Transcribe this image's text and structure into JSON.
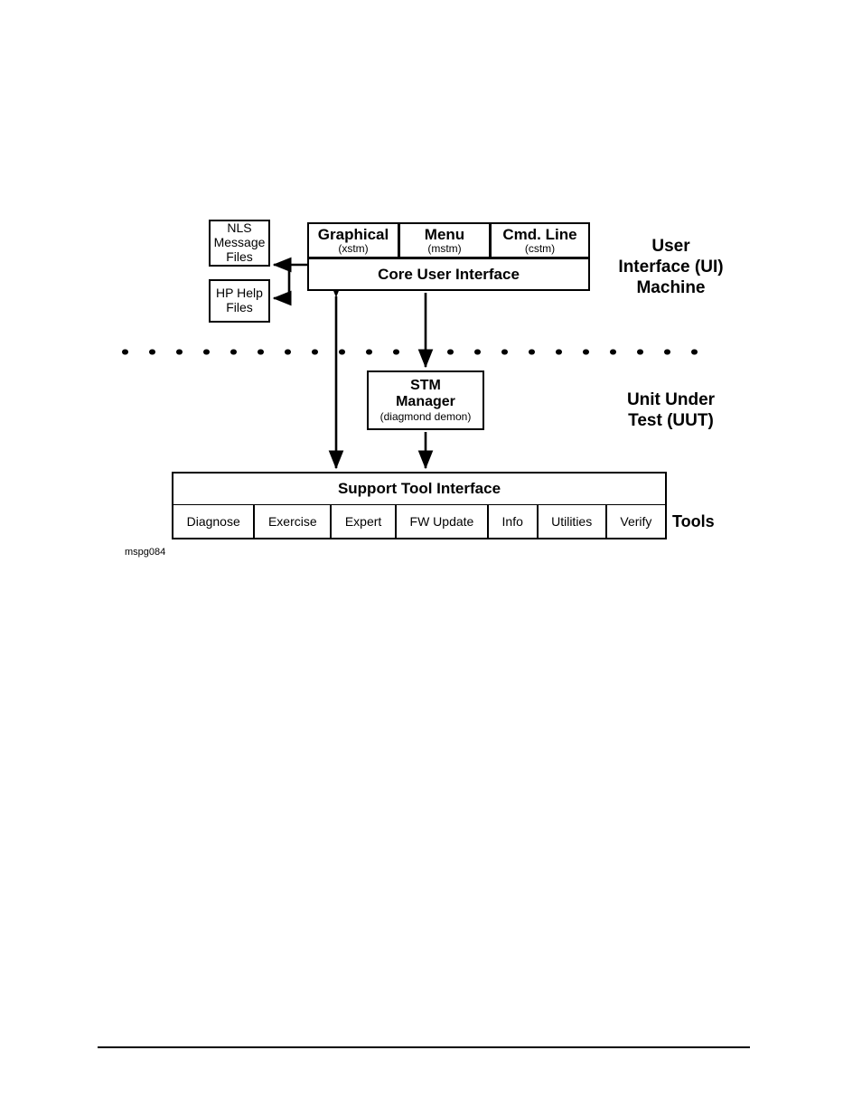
{
  "diagram": {
    "caption": "mspg084",
    "left_boxes": [
      {
        "name": "nls-message-files",
        "lines": [
          "NLS",
          "Message",
          "Files"
        ]
      },
      {
        "name": "hp-help-files",
        "lines": [
          "HP Help",
          "Files"
        ]
      }
    ],
    "interfaces": [
      {
        "title": "Graphical",
        "sub": "(xstm)"
      },
      {
        "title": "Menu",
        "sub": "(mstm)"
      },
      {
        "title": "Cmd. Line",
        "sub": "(cstm)"
      }
    ],
    "core_ui": "Core User Interface",
    "stm_manager": {
      "title_line1": "STM",
      "title_line2": "Manager",
      "sub": "(diagmond demon)"
    },
    "support_tool_interface": "Support Tool Interface",
    "tools": [
      "Diagnose",
      "Exercise",
      "Expert",
      "FW Update",
      "Info",
      "Utilities",
      "Verify"
    ],
    "side_labels": {
      "ui_machine_line1": "User",
      "ui_machine_line2": "Interface (UI)",
      "ui_machine_line3": "Machine",
      "uut_line1": "Unit Under",
      "uut_line2": "Test (UUT)",
      "tools": "Tools"
    },
    "colors": {
      "stroke": "#000000",
      "background": "#ffffff"
    }
  }
}
